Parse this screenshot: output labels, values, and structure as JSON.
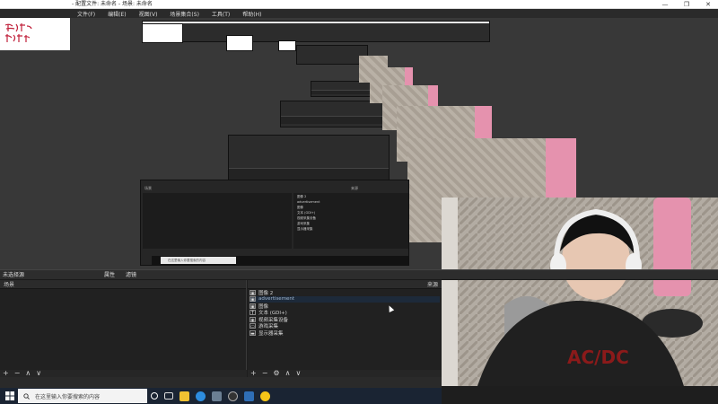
{
  "window": {
    "title": "- 配置文件: 未命名 - 场景: 未命名",
    "controls": {
      "minimize": "—",
      "maximize": "❐",
      "close": "✕"
    }
  },
  "menu": [
    "文件(F)",
    "编辑(E)",
    "视图(V)",
    "场景集合(S)",
    "工具(T)",
    "帮助(H)"
  ],
  "scene_bar": {
    "label": "未选择源",
    "properties": "属性",
    "filters": "滤镜"
  },
  "scenes_dock": {
    "title": "场景",
    "items": [
      ""
    ]
  },
  "sources_dock": {
    "title": "来源",
    "items": [
      {
        "icon": "image-icon",
        "label": "图像 2",
        "selected": false
      },
      {
        "icon": "image-icon",
        "label": "advertisement",
        "selected": true
      },
      {
        "icon": "image-icon",
        "label": "图像",
        "selected": false
      },
      {
        "icon": "text-icon",
        "label": "文本 (GDI+)",
        "selected": false
      },
      {
        "icon": "camera-icon",
        "label": "视频采集设备",
        "selected": false
      },
      {
        "icon": "window-icon",
        "label": "游戏采集",
        "selected": false
      },
      {
        "icon": "monitor-icon",
        "label": "显示器采集",
        "selected": false
      }
    ]
  },
  "toolbar_glyphs": {
    "add": "+",
    "remove": "−",
    "up": "∧",
    "down": "∨",
    "settings": "⚙"
  },
  "taskbar": {
    "search_placeholder": "在这里输入你要搜索的内容",
    "apps": [
      "taskview",
      "explorer",
      "edge",
      "notes",
      "obs",
      "settings",
      "files"
    ]
  },
  "mid_obs": {
    "scenes_title": "场景",
    "sources_title": "来源",
    "search_placeholder": "在这里输入你要搜索的内容",
    "sources": [
      "图像 2",
      "advertisement",
      "图像",
      "文本 (GDI+)",
      "视频采集设备",
      "游戏采集",
      "显示器采集"
    ]
  },
  "colors": {
    "accent": "#1d2a3a",
    "pink": "#e592ae",
    "taskbar": "#1a2433"
  }
}
